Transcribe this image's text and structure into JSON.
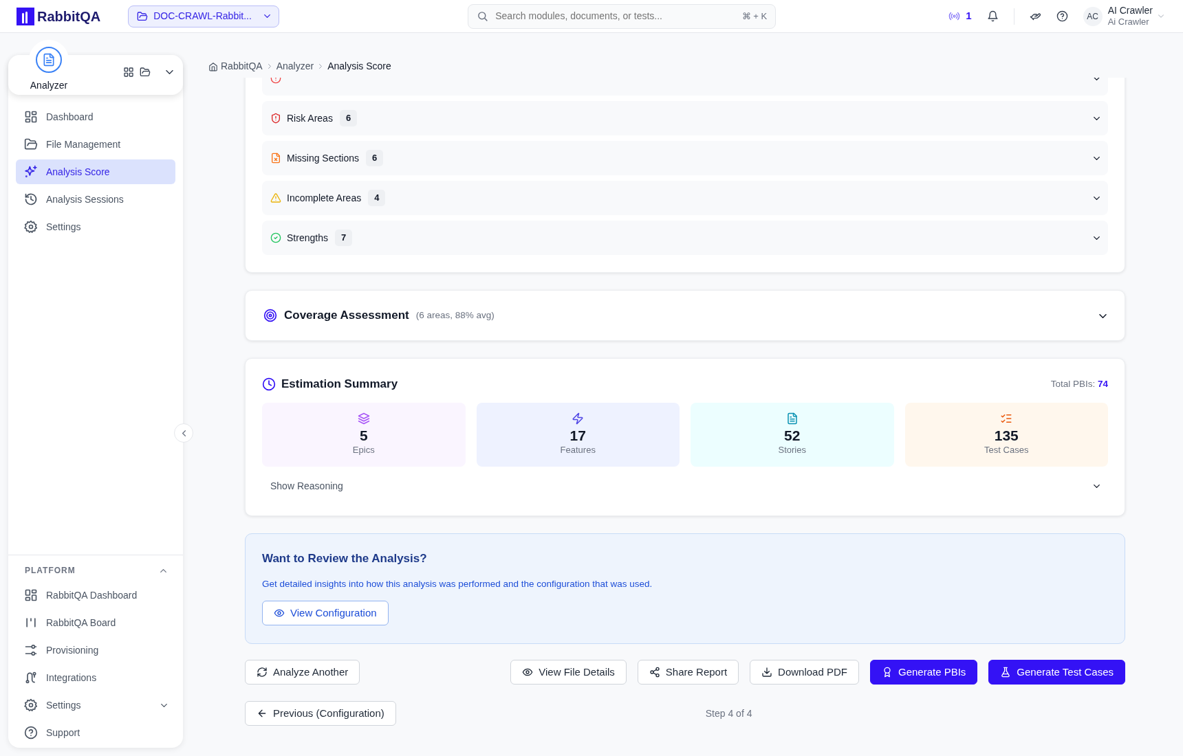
{
  "header": {
    "logo": "RabbitQA",
    "project": "DOC-CRAWL-Rabbit...",
    "search_placeholder": "Search modules, documents, or tests...",
    "shortcut": "⌘ + K",
    "live_count": "1",
    "user": {
      "initials": "AC",
      "name": "AI Crawler",
      "subtitle": "Ai Crawler"
    }
  },
  "sidebar": {
    "module": "Analyzer",
    "items": [
      {
        "label": "Dashboard",
        "selected": false
      },
      {
        "label": "File Management",
        "selected": false
      },
      {
        "label": "Analysis Score",
        "selected": true
      },
      {
        "label": "Analysis Sessions",
        "selected": false
      },
      {
        "label": "Settings",
        "selected": false
      }
    ],
    "platform": {
      "title": "PLATFORM",
      "expanded": true,
      "items": [
        {
          "label": "RabbitQA Dashboard",
          "expandable": false
        },
        {
          "label": "RabbitQA Board",
          "expandable": false
        },
        {
          "label": "Provisioning",
          "expandable": false
        },
        {
          "label": "Integrations",
          "expandable": false
        },
        {
          "label": "Settings",
          "expandable": true
        },
        {
          "label": "Support",
          "expandable": false
        }
      ]
    }
  },
  "breadcrumb": [
    "RabbitQA",
    "Analyzer",
    "Analysis Score"
  ],
  "findings": [
    {
      "kind": "weakness"
    },
    {
      "label": "Risk Areas",
      "count": "6",
      "kind": "risk"
    },
    {
      "label": "Missing Sections",
      "count": "6",
      "kind": "missing"
    },
    {
      "label": "Incomplete Areas",
      "count": "4",
      "kind": "incomplete"
    },
    {
      "label": "Strengths",
      "count": "7",
      "kind": "strength"
    }
  ],
  "coverage": {
    "title": "Coverage Assessment",
    "summary": "(6 areas, 88% avg)"
  },
  "estimation": {
    "title": "Estimation Summary",
    "total_label": "Total PBIs:",
    "total": "74",
    "reasoning": "Show Reasoning",
    "cards": [
      {
        "value": "5",
        "label": "Epics",
        "kind": "epics"
      },
      {
        "value": "17",
        "label": "Features",
        "kind": "features"
      },
      {
        "value": "52",
        "label": "Stories",
        "kind": "stories"
      },
      {
        "value": "135",
        "label": "Test Cases",
        "kind": "tests"
      }
    ]
  },
  "review": {
    "title": "Want to Review the Analysis?",
    "text": "Get detailed insights into how this analysis was performed and the configuration that was used.",
    "button": "View Configuration"
  },
  "actions": [
    {
      "label": "Analyze Another",
      "kind": "outline"
    },
    {
      "label": "View File Details",
      "kind": "outline"
    },
    {
      "label": "Share Report",
      "kind": "outline"
    },
    {
      "label": "Download PDF",
      "kind": "outline"
    },
    {
      "label": "Generate PBIs",
      "kind": "primary"
    },
    {
      "label": "Generate Test Cases",
      "kind": "primary"
    }
  ],
  "back": "Previous (Configuration)",
  "step": "Step 4 of 4"
}
